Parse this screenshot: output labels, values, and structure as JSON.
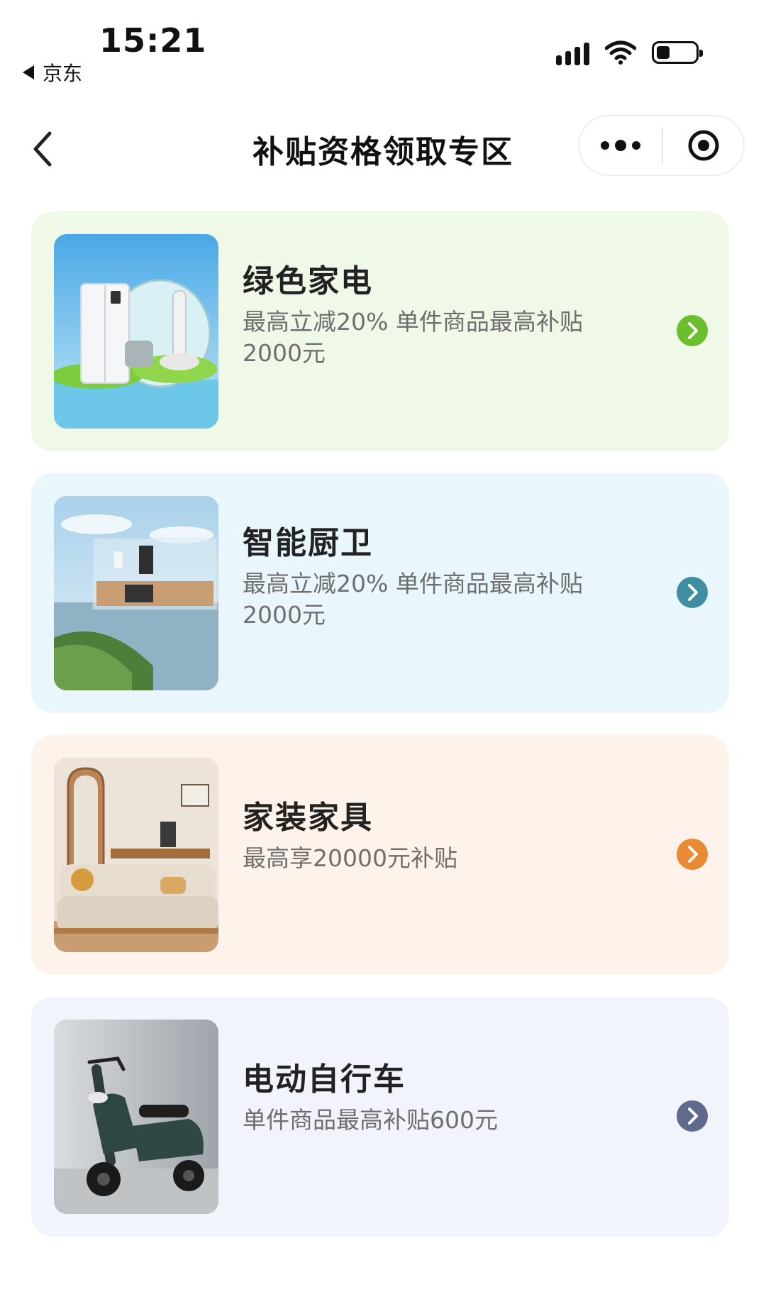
{
  "status_bar": {
    "time": "15:21",
    "back_app": "京东",
    "icons": [
      "signal-icon",
      "wifi-icon",
      "battery-icon"
    ]
  },
  "nav": {
    "title": "补贴资格领取专区",
    "back_icon": "chevron-left-icon",
    "more_icon": "more-dots-icon",
    "target_icon": "target-icon"
  },
  "cards": [
    {
      "title": "绿色家电",
      "desc": "最高立减20% 单件商品最高补贴2000元",
      "bg": "#f0f9e8",
      "accent": "#6cbf2c"
    },
    {
      "title": "智能厨卫",
      "desc": "最高立减20% 单件商品最高补贴2000元",
      "bg": "#e9f6fb",
      "accent": "#3f8fa3"
    },
    {
      "title": "家装家具",
      "desc": "最高享20000元补贴",
      "bg": "#fdf3ea",
      "accent": "#ea8a34"
    },
    {
      "title": "电动自行车",
      "desc": "单件商品最高补贴600元",
      "bg": "#f1f4fc",
      "accent": "#5f6a8c"
    }
  ]
}
